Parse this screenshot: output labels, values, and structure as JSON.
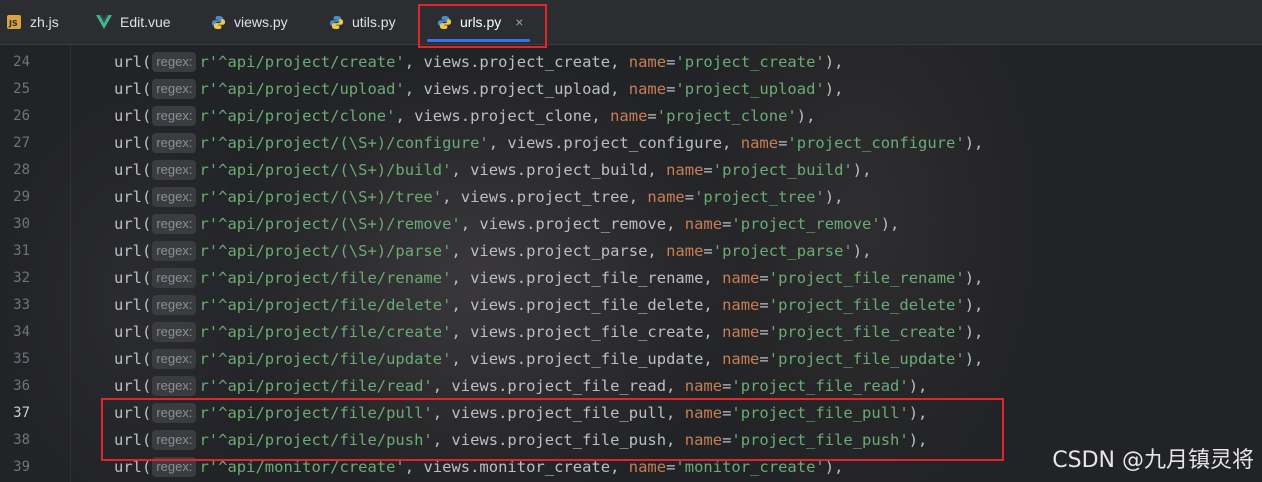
{
  "tabs": [
    {
      "label": "zh.js",
      "icon": "js-file-icon",
      "active": false
    },
    {
      "label": "Edit.vue",
      "icon": "vue-file-icon",
      "active": false
    },
    {
      "label": "views.py",
      "icon": "python-file-icon",
      "active": false
    },
    {
      "label": "utils.py",
      "icon": "python-file-icon",
      "active": false
    },
    {
      "label": "urls.py",
      "icon": "python-file-icon",
      "active": true,
      "close": "×"
    }
  ],
  "hint_label": "regex:",
  "code_lines": [
    {
      "num": "24",
      "fn": "url(",
      "str": "r'^api/project/create'",
      "mid": ", views.project_create, ",
      "kw": "name",
      "eq": "=",
      "name_val": "'project_create'",
      "end": "),"
    },
    {
      "num": "25",
      "fn": "url(",
      "str": "r'^api/project/upload'",
      "mid": ", views.project_upload, ",
      "kw": "name",
      "eq": "=",
      "name_val": "'project_upload'",
      "end": "),"
    },
    {
      "num": "26",
      "fn": "url(",
      "str": "r'^api/project/clone'",
      "mid": ", views.project_clone, ",
      "kw": "name",
      "eq": "=",
      "name_val": "'project_clone'",
      "end": "),"
    },
    {
      "num": "27",
      "fn": "url(",
      "str": "r'^api/project/(\\S+)/configure'",
      "mid": ", views.project_configure, ",
      "kw": "name",
      "eq": "=",
      "name_val": "'project_configure'",
      "end": "),"
    },
    {
      "num": "28",
      "fn": "url(",
      "str": "r'^api/project/(\\S+)/build'",
      "mid": ", views.project_build, ",
      "kw": "name",
      "eq": "=",
      "name_val": "'project_build'",
      "end": "),"
    },
    {
      "num": "29",
      "fn": "url(",
      "str": "r'^api/project/(\\S+)/tree'",
      "mid": ", views.project_tree, ",
      "kw": "name",
      "eq": "=",
      "name_val": "'project_tree'",
      "end": "),"
    },
    {
      "num": "30",
      "fn": "url(",
      "str": "r'^api/project/(\\S+)/remove'",
      "mid": ", views.project_remove, ",
      "kw": "name",
      "eq": "=",
      "name_val": "'project_remove'",
      "end": "),"
    },
    {
      "num": "31",
      "fn": "url(",
      "str": "r'^api/project/(\\S+)/parse'",
      "mid": ", views.project_parse, ",
      "kw": "name",
      "eq": "=",
      "name_val": "'project_parse'",
      "end": "),"
    },
    {
      "num": "32",
      "fn": "url(",
      "str": "r'^api/project/file/rename'",
      "mid": ", views.project_file_rename, ",
      "kw": "name",
      "eq": "=",
      "name_val": "'project_file_rename'",
      "end": "),"
    },
    {
      "num": "33",
      "fn": "url(",
      "str": "r'^api/project/file/delete'",
      "mid": ", views.project_file_delete, ",
      "kw": "name",
      "eq": "=",
      "name_val": "'project_file_delete'",
      "end": "),"
    },
    {
      "num": "34",
      "fn": "url(",
      "str": "r'^api/project/file/create'",
      "mid": ", views.project_file_create, ",
      "kw": "name",
      "eq": "=",
      "name_val": "'project_file_create'",
      "end": "),"
    },
    {
      "num": "35",
      "fn": "url(",
      "str": "r'^api/project/file/update'",
      "mid": ", views.project_file_update, ",
      "kw": "name",
      "eq": "=",
      "name_val": "'project_file_update'",
      "end": "),"
    },
    {
      "num": "36",
      "fn": "url(",
      "str": "r'^api/project/file/read'",
      "mid": ", views.project_file_read, ",
      "kw": "name",
      "eq": "=",
      "name_val": "'project_file_read'",
      "end": "),"
    },
    {
      "num": "37",
      "fn": "url(",
      "str": "r'^api/project/file/pull'",
      "mid": ", views.project_file_pull, ",
      "kw": "name",
      "eq": "=",
      "name_val": "'project_file_pull'",
      "end": "),"
    },
    {
      "num": "38",
      "fn": "url(",
      "str": "r'^api/project/file/push'",
      "mid": ", views.project_file_push, ",
      "kw": "name",
      "eq": "=",
      "name_val": "'project_file_push'",
      "end": "),"
    },
    {
      "num": "39",
      "fn": "url(",
      "str": "r'^api/monitor/create'",
      "mid": ", views.monitor_create, ",
      "kw": "name",
      "eq": "=",
      "name_val": "'monitor_create'",
      "end": "),"
    }
  ],
  "current_line": "37",
  "watermark": "CSDN @九月镇灵将",
  "colors": {
    "string": "#6aab73",
    "keyword": "#c77e54",
    "text": "#bcbec4",
    "highlight_box": "#e0262a",
    "tab_underline": "#3574f0"
  }
}
